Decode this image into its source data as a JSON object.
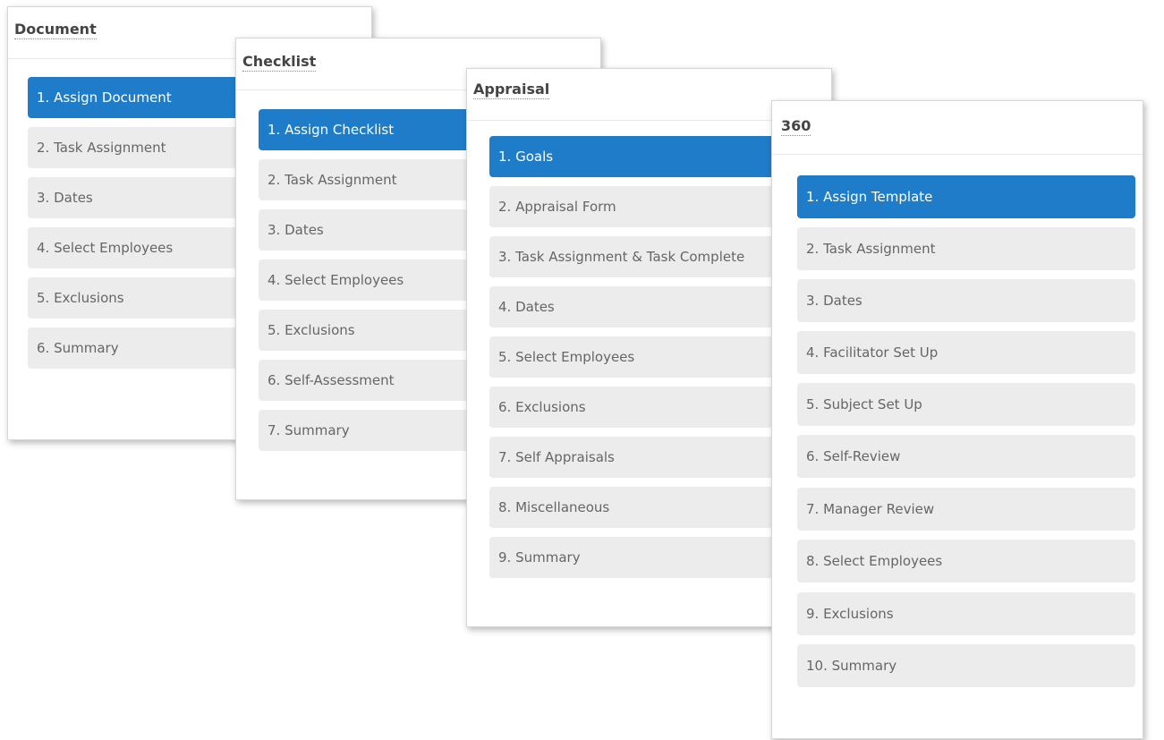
{
  "colors": {
    "active_step": "#1f7cc9",
    "inactive_step": "#ececec",
    "panel_border": "#d6d6d6",
    "title_text": "#444444",
    "step_text": "#666666"
  },
  "panels": [
    {
      "title": "Document",
      "steps": [
        "1. Assign Document",
        "2. Task Assignment",
        "3. Dates",
        "4. Select Employees",
        "5. Exclusions",
        "6. Summary"
      ]
    },
    {
      "title": "Checklist",
      "steps": [
        "1. Assign Checklist",
        "2. Task Assignment",
        "3. Dates",
        "4. Select Employees",
        "5. Exclusions",
        "6. Self-Assessment",
        "7. Summary"
      ]
    },
    {
      "title": "Appraisal",
      "steps": [
        "1. Goals",
        "2. Appraisal Form",
        "3. Task Assignment & Task Complete",
        "4. Dates",
        "5. Select Employees",
        "6. Exclusions",
        "7. Self Appraisals",
        "8. Miscellaneous",
        "9. Summary"
      ]
    },
    {
      "title": "360",
      "steps": [
        "1. Assign Template",
        "2. Task Assignment",
        "3. Dates",
        "4. Facilitator Set Up",
        "5. Subject Set Up",
        "6. Self-Review",
        "7. Manager Review",
        "8. Select Employees",
        "9. Exclusions",
        "10. Summary"
      ]
    }
  ]
}
